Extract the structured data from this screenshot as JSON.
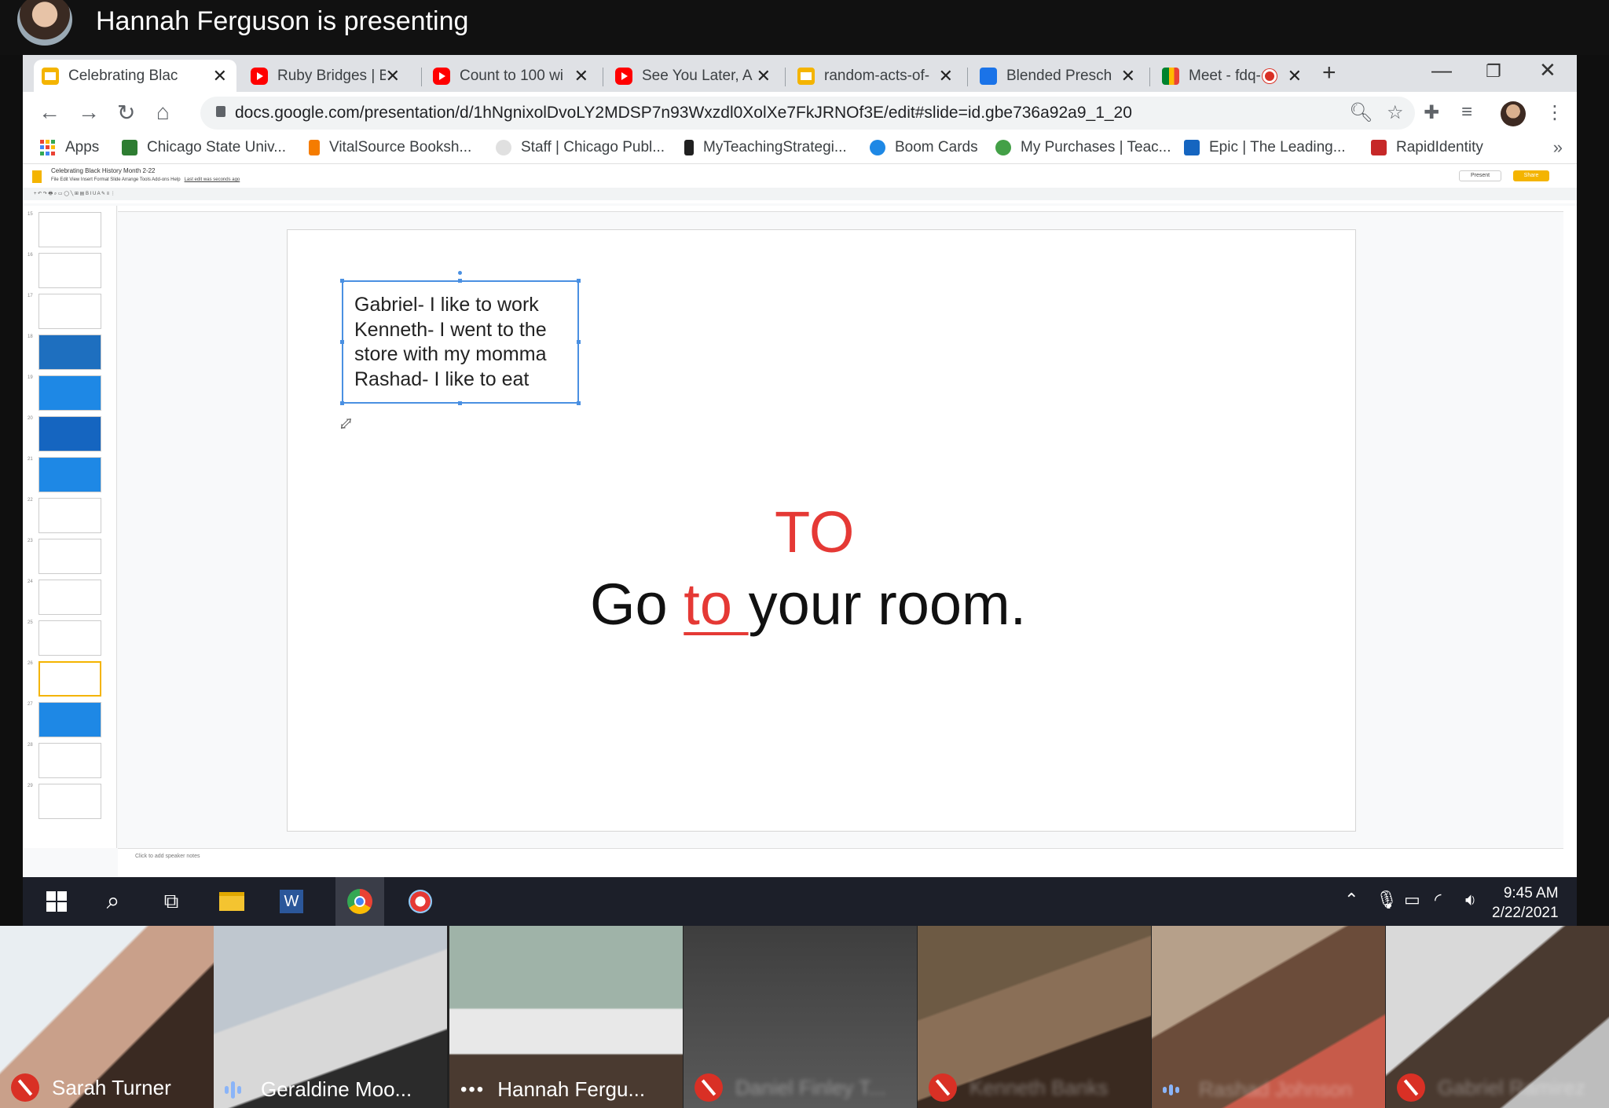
{
  "presenter": {
    "text": "Hannah Ferguson is presenting"
  },
  "browser": {
    "tabs": [
      {
        "label": "Celebrating Blac",
        "icon": "slides-icon",
        "active": true
      },
      {
        "label": "Ruby Bridges | B",
        "icon": "youtube-icon"
      },
      {
        "label": "Count to 100 wi",
        "icon": "youtube-icon"
      },
      {
        "label": "See You Later, A",
        "icon": "youtube-icon"
      },
      {
        "label": "random-acts-of-",
        "icon": "slides-icon"
      },
      {
        "label": "Blended Presch",
        "icon": "classroom-icon"
      },
      {
        "label": "Meet - fdq-",
        "icon": "meet-icon"
      }
    ],
    "url": "docs.google.com/presentation/d/1hNgnixolDvoLY2MDSP7n93Wxzdl0XolXe7FkJRNOf3E/edit#slide=id.gbe736a92a9_1_20",
    "bookmarks": [
      {
        "label": "Apps",
        "color": "#ea4335"
      },
      {
        "label": "Chicago State Univ...",
        "color": "#2e7d32"
      },
      {
        "label": "VitalSource Booksh...",
        "color": "#f57c00"
      },
      {
        "label": "Staff | Chicago Publ...",
        "color": "#9e9e9e"
      },
      {
        "label": "MyTeachingStrategi...",
        "color": "#212121"
      },
      {
        "label": "Boom Cards",
        "color": "#1e88e5"
      },
      {
        "label": "My Purchases | Teac...",
        "color": "#43a047"
      },
      {
        "label": "Epic | The Leading...",
        "color": "#1565c0"
      },
      {
        "label": "RapidIdentity",
        "color": "#c62828"
      }
    ]
  },
  "slides": {
    "doc_title": "Celebrating Black History Month 2-22",
    "menu": "File  Edit  View  Insert  Format  Slide  Arrange  Tools  Add-ons  Help",
    "last_edit": "Last edit was seconds ago",
    "present_label": "Present",
    "share_label": "Share",
    "notes_placeholder": "Click to add speaker notes",
    "thumb_numbers": [
      "15",
      "16",
      "17",
      "18",
      "19",
      "20",
      "21",
      "22",
      "23",
      "24",
      "25",
      "26",
      "27",
      "28",
      "29"
    ],
    "selected_thumb": "26",
    "textbox_lines": [
      "Gabriel- I like to work",
      "Kenneth- I went to the",
      "store with my momma",
      "Rashad- I like to eat"
    ],
    "heading": "TO",
    "sentence": {
      "before": "Go ",
      "highlight": "to ",
      "after": "your room."
    },
    "accent_color": "#e53935"
  },
  "taskbar": {
    "time": "9:45 AM",
    "date": "2/22/2021"
  },
  "participants": [
    {
      "name": "Sarah Turner",
      "status": "muted"
    },
    {
      "name": "Geraldine Moo...",
      "status": "speaking"
    },
    {
      "name": "Hannah Fergu...",
      "status": "options"
    },
    {
      "name": "Daniel Finley T...",
      "status": "muted"
    },
    {
      "name": "Kenneth Banks",
      "status": "muted"
    },
    {
      "name": "Rashad Johnson",
      "status": "speaking"
    },
    {
      "name": "Gabriel Ramirez",
      "status": "muted"
    }
  ]
}
